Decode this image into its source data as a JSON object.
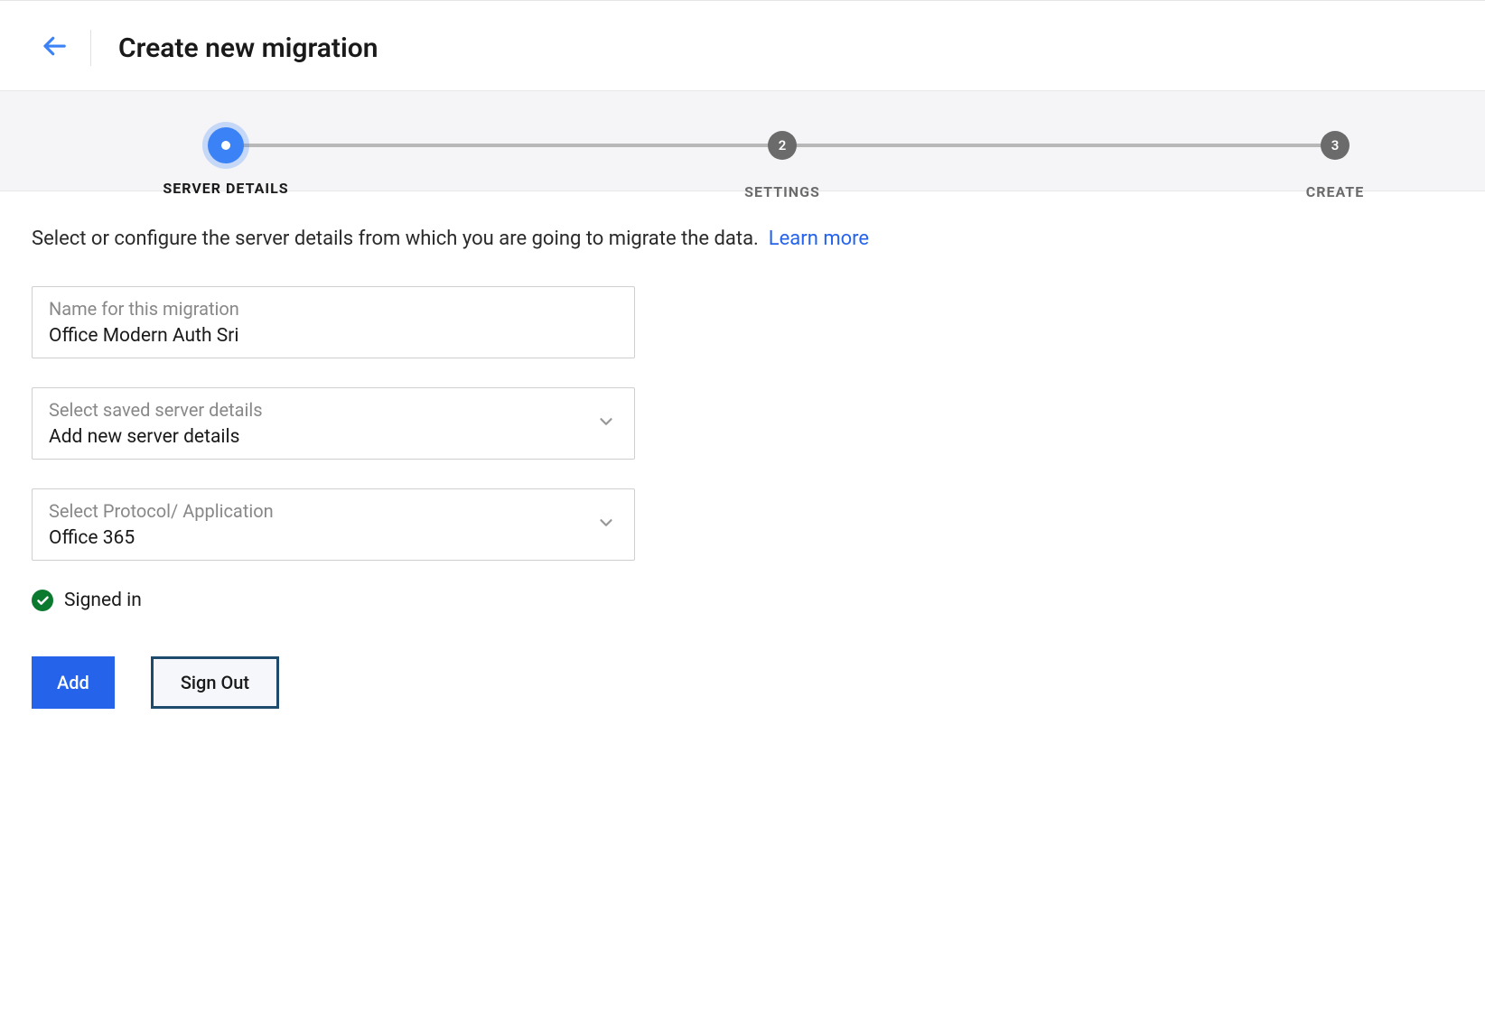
{
  "header": {
    "title": "Create new migration"
  },
  "stepper": {
    "steps": [
      {
        "label": "SERVER DETAILS",
        "num": ""
      },
      {
        "label": "SETTINGS",
        "num": "2"
      },
      {
        "label": "CREATE",
        "num": "3"
      }
    ]
  },
  "main": {
    "instruction": "Select or configure the server details from which you are going to migrate the data.",
    "learn_more": "Learn more",
    "fields": {
      "name": {
        "label": "Name for this migration",
        "value": "Office Modern Auth Sri"
      },
      "saved_server": {
        "label": "Select saved server details",
        "value": "Add new server details"
      },
      "protocol": {
        "label": "Select Protocol/ Application",
        "value": "Office 365"
      }
    },
    "status": {
      "text": "Signed in"
    },
    "buttons": {
      "add": "Add",
      "signout": "Sign Out"
    }
  }
}
